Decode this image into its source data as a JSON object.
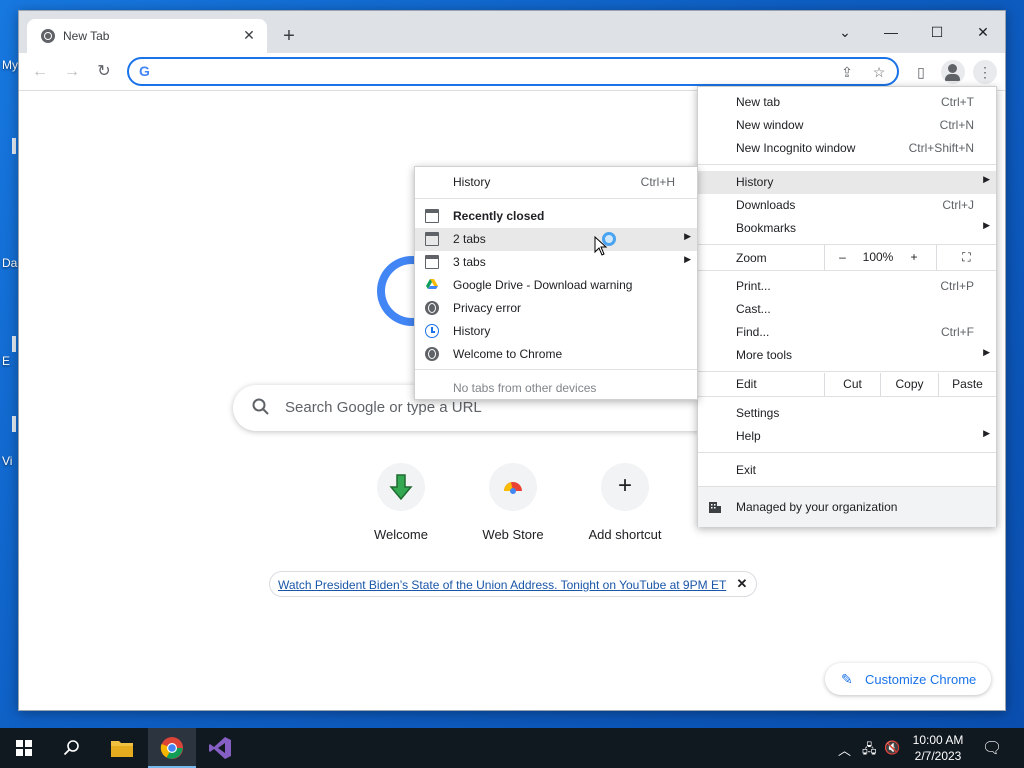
{
  "desktop": {
    "labels": [
      "My",
      "Da",
      "E",
      "Vi"
    ]
  },
  "tab": {
    "title": "New Tab",
    "close": "✕"
  },
  "toolbar": {
    "omnibox_value": "",
    "omnibox_logo": "G"
  },
  "window_controls": {
    "chevron": "⌄",
    "minimize": "—",
    "maximize": "☐",
    "close": "✕"
  },
  "ntp": {
    "search_placeholder": "Search Google or type a URL",
    "shortcuts": [
      {
        "label": "Welcome",
        "icon": "welcome-arrow-icon"
      },
      {
        "label": "Web Store",
        "icon": "web-store-icon"
      },
      {
        "label": "Add shortcut",
        "icon": "plus-icon"
      }
    ],
    "promo_text": "Watch President Biden’s State of the Union Address. Tonight on YouTube at 9PM ET",
    "customize_label": "Customize Chrome"
  },
  "main_menu": {
    "new_tab": {
      "label": "New tab",
      "shortcut": "Ctrl+T"
    },
    "new_window": {
      "label": "New window",
      "shortcut": "Ctrl+N"
    },
    "new_incognito": {
      "label": "New Incognito window",
      "shortcut": "Ctrl+Shift+N"
    },
    "history": {
      "label": "History"
    },
    "downloads": {
      "label": "Downloads",
      "shortcut": "Ctrl+J"
    },
    "bookmarks": {
      "label": "Bookmarks"
    },
    "zoom": {
      "label": "Zoom",
      "minus": "–",
      "value": "100%",
      "plus": "+"
    },
    "print": {
      "label": "Print...",
      "shortcut": "Ctrl+P"
    },
    "cast": {
      "label": "Cast..."
    },
    "find": {
      "label": "Find...",
      "shortcut": "Ctrl+F"
    },
    "more_tools": {
      "label": "More tools"
    },
    "edit": {
      "label": "Edit",
      "cut": "Cut",
      "copy": "Copy",
      "paste": "Paste"
    },
    "settings": {
      "label": "Settings"
    },
    "help": {
      "label": "Help"
    },
    "exit": {
      "label": "Exit"
    },
    "managed": {
      "label": "Managed by your organization"
    }
  },
  "history_menu": {
    "history": {
      "label": "History",
      "shortcut": "Ctrl+H"
    },
    "recently_closed": "Recently closed",
    "items": [
      {
        "label": "2 tabs",
        "icon": "tabs-icon"
      },
      {
        "label": "3 tabs",
        "icon": "tabs-icon"
      },
      {
        "label": "Google Drive - Download warning",
        "icon": "google-drive-icon"
      },
      {
        "label": "Privacy error",
        "icon": "globe-icon"
      },
      {
        "label": "History",
        "icon": "history-icon"
      },
      {
        "label": "Welcome to Chrome",
        "icon": "globe-icon"
      }
    ],
    "no_tabs": "No tabs from other devices"
  },
  "taskbar": {
    "time": "10:00 AM",
    "date": "2/7/2023"
  }
}
